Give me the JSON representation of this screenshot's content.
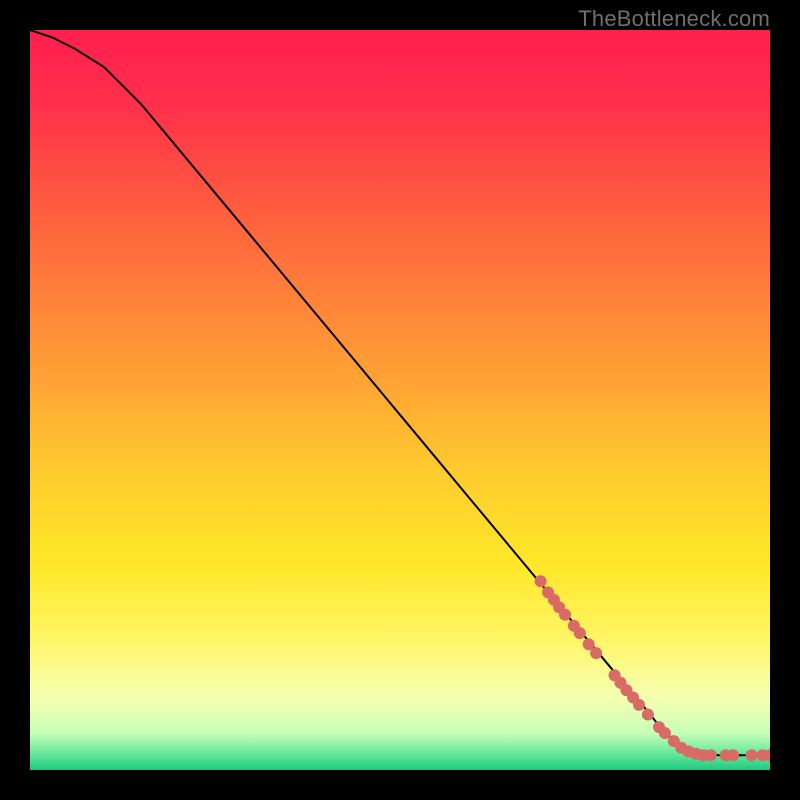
{
  "watermark": "TheBottleneck.com",
  "chart_data": {
    "type": "line",
    "title": "",
    "xlabel": "",
    "ylabel": "",
    "xlim": [
      0,
      100
    ],
    "ylim": [
      0,
      100
    ],
    "curve": {
      "name": "bottleneck-curve",
      "x": [
        0,
        3,
        6,
        10,
        15,
        20,
        25,
        30,
        35,
        40,
        45,
        50,
        55,
        60,
        65,
        70,
        75,
        80,
        83,
        85,
        87,
        90,
        93,
        96,
        100
      ],
      "y": [
        100,
        99,
        97.5,
        95,
        90,
        84,
        78,
        72,
        66,
        60,
        54,
        48,
        42,
        36,
        30,
        24,
        18,
        12,
        8.5,
        6,
        4,
        2.5,
        2,
        2,
        2
      ]
    },
    "markers": {
      "name": "highlighted-points",
      "color": "#d96a66",
      "points": [
        {
          "x": 69.0,
          "y": 25.5
        },
        {
          "x": 70.0,
          "y": 24.0
        },
        {
          "x": 70.8,
          "y": 23.0
        },
        {
          "x": 71.5,
          "y": 22.0
        },
        {
          "x": 72.3,
          "y": 21.0
        },
        {
          "x": 73.5,
          "y": 19.5
        },
        {
          "x": 74.3,
          "y": 18.5
        },
        {
          "x": 75.5,
          "y": 17.0
        },
        {
          "x": 76.5,
          "y": 15.8
        },
        {
          "x": 79.0,
          "y": 12.8
        },
        {
          "x": 79.8,
          "y": 11.8
        },
        {
          "x": 80.6,
          "y": 10.8
        },
        {
          "x": 81.5,
          "y": 9.8
        },
        {
          "x": 82.3,
          "y": 8.8
        },
        {
          "x": 83.5,
          "y": 7.5
        },
        {
          "x": 85.0,
          "y": 5.8
        },
        {
          "x": 85.8,
          "y": 5.0
        },
        {
          "x": 87.0,
          "y": 3.9
        },
        {
          "x": 88.0,
          "y": 3.0
        },
        {
          "x": 89.0,
          "y": 2.5
        },
        {
          "x": 90.0,
          "y": 2.2
        },
        {
          "x": 91.0,
          "y": 2.0
        },
        {
          "x": 92.0,
          "y": 2.0
        },
        {
          "x": 94.0,
          "y": 2.0
        },
        {
          "x": 95.0,
          "y": 2.0
        },
        {
          "x": 97.5,
          "y": 2.0
        },
        {
          "x": 99.0,
          "y": 2.0
        },
        {
          "x": 100.0,
          "y": 2.0
        }
      ]
    },
    "gradient_stops": [
      {
        "pct": 0,
        "color": "#ff1f4f"
      },
      {
        "pct": 10,
        "color": "#ff2f4a"
      },
      {
        "pct": 22,
        "color": "#ff5640"
      },
      {
        "pct": 35,
        "color": "#ff7e3a"
      },
      {
        "pct": 48,
        "color": "#ffa534"
      },
      {
        "pct": 60,
        "color": "#ffcc2e"
      },
      {
        "pct": 72,
        "color": "#ffe728"
      },
      {
        "pct": 82,
        "color": "#fff564"
      },
      {
        "pct": 90,
        "color": "#f7ffb0"
      },
      {
        "pct": 95,
        "color": "#c7ffb8"
      },
      {
        "pct": 98,
        "color": "#5fe59a"
      },
      {
        "pct": 100,
        "color": "#1fc97f"
      }
    ]
  }
}
